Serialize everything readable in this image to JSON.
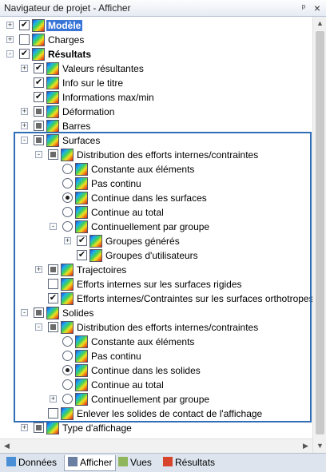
{
  "window": {
    "title": "Navigateur de projet - Afficher",
    "pin_glyph": "ᵖ",
    "close_glyph": "×"
  },
  "tree": [
    {
      "label": "Modèle",
      "expander": "+",
      "check": "checked",
      "icon": "model-icon",
      "selected": true,
      "bold": true
    },
    {
      "label": "Charges",
      "expander": "+",
      "check": "unchecked",
      "icon": "load-icon"
    },
    {
      "label": "Résultats",
      "expander": "-",
      "check": "checked",
      "icon": "results-icon",
      "bold": true
    },
    {
      "label": "Valeurs résultantes",
      "expander": "+",
      "check": "checked",
      "icon": "results-icon"
    },
    {
      "label": "Info sur le titre",
      "check": "checked",
      "icon": "results-icon"
    },
    {
      "label": "Informations max/min",
      "check": "checked",
      "icon": "results-icon"
    },
    {
      "label": "Déformation",
      "expander": "+",
      "check": "indeterminate",
      "icon": "results-icon"
    },
    {
      "label": "Barres",
      "expander": "+",
      "check": "indeterminate",
      "icon": "results-icon"
    },
    {
      "label": "Surfaces",
      "expander": "-",
      "check": "indeterminate",
      "icon": "results-icon"
    },
    {
      "label": "Distribution des efforts internes/contraintes",
      "expander": "-",
      "check": "indeterminate",
      "icon": "results-icon"
    },
    {
      "label": "Constante aux éléments",
      "radio": false,
      "icon": "results-icon"
    },
    {
      "label": "Pas continu",
      "radio": false,
      "icon": "results-icon"
    },
    {
      "label": "Continue dans les surfaces",
      "radio": true,
      "icon": "results-icon"
    },
    {
      "label": "Continue au total",
      "radio": false,
      "icon": "results-icon"
    },
    {
      "label": "Continuellement par groupe",
      "expander": "-",
      "radio": false,
      "icon": "results-icon"
    },
    {
      "label": "Groupes générés",
      "expander": "+",
      "check": "checked",
      "icon": "results-icon"
    },
    {
      "label": "Groupes d'utilisateurs",
      "check": "checked",
      "icon": "results-icon"
    },
    {
      "label": "Trajectoires",
      "expander": "+",
      "check": "indeterminate",
      "icon": "results-icon"
    },
    {
      "label": "Efforts internes sur les surfaces rigides",
      "check": "unchecked",
      "icon": "results-icon"
    },
    {
      "label": "Efforts internes/Contraintes sur les surfaces orthotropes",
      "check": "checked",
      "icon": "results-icon"
    },
    {
      "label": "Solides",
      "expander": "-",
      "check": "indeterminate",
      "icon": "results-icon"
    },
    {
      "label": "Distribution des efforts internes/contraintes",
      "expander": "-",
      "check": "indeterminate",
      "icon": "results-icon"
    },
    {
      "label": "Constante aux éléments",
      "radio": false,
      "icon": "results-icon"
    },
    {
      "label": "Pas continu",
      "radio": false,
      "icon": "results-icon"
    },
    {
      "label": "Continue dans les solides",
      "radio": true,
      "icon": "results-icon"
    },
    {
      "label": "Continue au total",
      "radio": false,
      "icon": "results-icon"
    },
    {
      "label": "Continuellement par groupe",
      "expander": "+",
      "radio": false,
      "icon": "results-icon"
    },
    {
      "label": "Enlever les solides de contact de l'affichage",
      "check": "unchecked",
      "icon": "results-icon"
    },
    {
      "label": "Type d'affichage",
      "expander": "+",
      "check": "indeterminate",
      "icon": "results-icon"
    }
  ],
  "tabs": [
    {
      "label": "Données",
      "icon": "data-icon"
    },
    {
      "label": "Afficher",
      "icon": "display-icon",
      "active": true
    },
    {
      "label": "Vues",
      "icon": "views-icon"
    },
    {
      "label": "Résultats",
      "icon": "results-tab-icon"
    }
  ],
  "check_glyph": "✔",
  "scroll": {
    "up": "▲",
    "down": "▼",
    "left": "◀",
    "right": "▶"
  }
}
